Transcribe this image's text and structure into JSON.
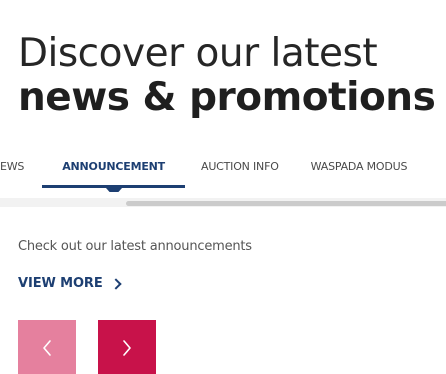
{
  "heading": {
    "line1": "Discover our latest",
    "line2": "news & promotions"
  },
  "tabs": [
    {
      "label": "NEWS",
      "visible_label": "EWS",
      "active": false
    },
    {
      "label": "ANNOUNCEMENT",
      "active": true
    },
    {
      "label": "AUCTION INFO",
      "active": false
    },
    {
      "label": "WASPADA MODUS",
      "active": false
    }
  ],
  "section": {
    "intro": "Check out our latest announcements",
    "view_more_label": "VIEW MORE"
  },
  "carousel": {
    "prev_icon": "chevron-left-icon",
    "next_icon": "chevron-right-icon"
  },
  "colors": {
    "accent_navy": "#1d3f72",
    "brand_red": "#c8124a",
    "brand_red_light": "#e5809e"
  }
}
